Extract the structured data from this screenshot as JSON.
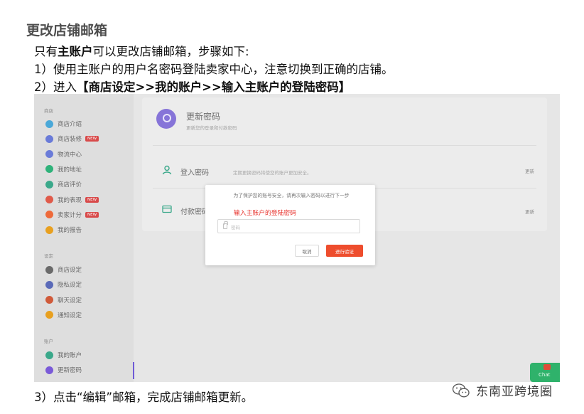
{
  "doc": {
    "title": "更改店铺邮箱",
    "line1": {
      "prefix": "只有",
      "bold": "主账户",
      "suffix": "可以更改店铺邮箱，步骤如下:"
    },
    "line2": "1）使用主账户的用户名密码登陆卖家中心，注意切换到正确的店铺。",
    "line3": {
      "prefix": "2）进入",
      "bold": "【商店设定>>我的账户>>输入主账户的登陆密码】"
    },
    "line4": "3）点击“编辑”邮箱，完成店铺邮箱更新。"
  },
  "sidebar": {
    "group1": "商店",
    "items1": [
      {
        "label": "商店介绍",
        "color": "#4aa8d8",
        "badge": ""
      },
      {
        "label": "商店装修",
        "color": "#6a7bd8",
        "badge": "NEW"
      },
      {
        "label": "物流中心",
        "color": "#6a7bd8",
        "badge": ""
      },
      {
        "label": "我的地址",
        "color": "#2fb27a",
        "badge": ""
      },
      {
        "label": "商店评价",
        "color": "#3aa88a",
        "badge": ""
      },
      {
        "label": "我的表现",
        "color": "#e05a4a",
        "badge": "NEW"
      },
      {
        "label": "卖家计分",
        "color": "#ee6a3a",
        "badge": "NEW"
      },
      {
        "label": "我的报告",
        "color": "#e8a020",
        "badge": ""
      }
    ],
    "group2": "设定",
    "items2": [
      {
        "label": "商店设定",
        "color": "#6a6a6a",
        "badge": ""
      },
      {
        "label": "隐私设定",
        "color": "#5a6ab8",
        "badge": ""
      },
      {
        "label": "聊天设定",
        "color": "#d05a3a",
        "badge": ""
      },
      {
        "label": "通知设定",
        "color": "#e8a020",
        "badge": ""
      }
    ],
    "group3": "账户",
    "items3": [
      {
        "label": "我的账户",
        "color": "#3aa88a",
        "badge": ""
      },
      {
        "label": "更新密码",
        "color": "#7a5ad8",
        "badge": ""
      }
    ]
  },
  "panel": {
    "title": "更新密码",
    "subtitle": "更新您的登录和付款密码",
    "rows": [
      {
        "label": "登入密码",
        "desc": "定期更换密码将使您的账户更加安全。",
        "action": "更新"
      },
      {
        "label": "付款密码",
        "desc": "",
        "action": "更新"
      }
    ]
  },
  "modal": {
    "message": "为了保护您的账号安全，请再次输入密码以进行下一步",
    "hint": "输入主账户的登陆密码",
    "placeholder": "密码",
    "cancel": "取消",
    "verify": "进行验证"
  },
  "chat": {
    "label": "Chat"
  },
  "watermark": "东南亚跨境圈",
  "colors": {
    "accent": "#ee4d2d",
    "hint": "#e8322c",
    "purple": "#8674d8"
  }
}
